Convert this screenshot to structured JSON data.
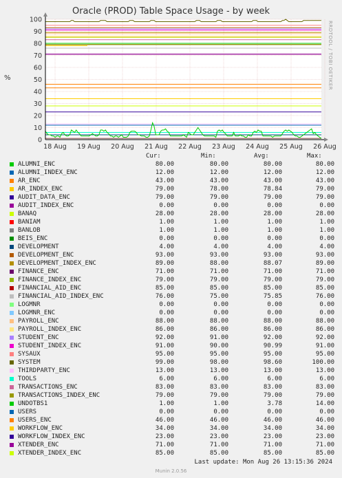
{
  "chart_data": {
    "type": "line",
    "title": "Oracle (PROD) Table Space Usage - by week",
    "ylabel": "%",
    "ylim": [
      0,
      100
    ],
    "yticks": [
      0,
      10,
      20,
      30,
      40,
      50,
      60,
      70,
      80,
      90,
      100
    ],
    "xticks": [
      "18 Aug",
      "19 Aug",
      "20 Aug",
      "21 Aug",
      "22 Aug",
      "23 Aug",
      "24 Aug",
      "25 Aug",
      "26 Aug"
    ],
    "grid": true,
    "header": {
      "cur": "Cur:",
      "min": "Min:",
      "avg": "Avg:",
      "max": "Max:"
    },
    "series": [
      {
        "name": "ALUMNI_ENC",
        "color": "#00cc00",
        "cur": "80.00",
        "min": "80.00",
        "avg": "80.00",
        "max": "80.00"
      },
      {
        "name": "ALUMNI_INDEX_ENC",
        "color": "#0066b3",
        "cur": "12.00",
        "min": "12.00",
        "avg": "12.00",
        "max": "12.00"
      },
      {
        "name": "AR_ENC",
        "color": "#ff8000",
        "cur": "43.00",
        "min": "43.00",
        "avg": "43.00",
        "max": "43.00"
      },
      {
        "name": "AR_INDEX_ENC",
        "color": "#ffcc00",
        "cur": "79.00",
        "min": "78.00",
        "avg": "78.84",
        "max": "79.00"
      },
      {
        "name": "AUDIT_DATA_ENC",
        "color": "#330099",
        "cur": "79.00",
        "min": "79.00",
        "avg": "79.00",
        "max": "79.00"
      },
      {
        "name": "AUDIT_INDEX_ENC",
        "color": "#990099",
        "cur": "0.00",
        "min": "0.00",
        "avg": "0.00",
        "max": "0.00"
      },
      {
        "name": "BANAQ",
        "color": "#ccff00",
        "cur": "28.00",
        "min": "28.00",
        "avg": "28.00",
        "max": "28.00"
      },
      {
        "name": "BANIAM",
        "color": "#ff0000",
        "cur": "1.00",
        "min": "1.00",
        "avg": "1.00",
        "max": "1.00"
      },
      {
        "name": "BANLOB",
        "color": "#808080",
        "cur": "1.00",
        "min": "1.00",
        "avg": "1.00",
        "max": "1.00"
      },
      {
        "name": "BEIS_ENC",
        "color": "#008f00",
        "cur": "0.00",
        "min": "0.00",
        "avg": "0.00",
        "max": "0.00"
      },
      {
        "name": "DEVELOPMENT",
        "color": "#00487d",
        "cur": "4.00",
        "min": "4.00",
        "avg": "4.00",
        "max": "4.00"
      },
      {
        "name": "DEVELOPMENT_ENC",
        "color": "#b35a00",
        "cur": "93.00",
        "min": "93.00",
        "avg": "93.00",
        "max": "93.00"
      },
      {
        "name": "DEVELOPMENT_INDEX_ENC",
        "color": "#b38f00",
        "cur": "89.00",
        "min": "88.00",
        "avg": "88.07",
        "max": "89.00"
      },
      {
        "name": "FINANCE_ENC",
        "color": "#6b006b",
        "cur": "71.00",
        "min": "71.00",
        "avg": "71.00",
        "max": "71.00"
      },
      {
        "name": "FINANCE_INDEX_ENC",
        "color": "#8fb300",
        "cur": "79.00",
        "min": "79.00",
        "avg": "79.00",
        "max": "79.00"
      },
      {
        "name": "FINANCIAL_AID_ENC",
        "color": "#b30000",
        "cur": "85.00",
        "min": "85.00",
        "avg": "85.00",
        "max": "85.00"
      },
      {
        "name": "FINANCIAL_AID_INDEX_ENC",
        "color": "#bebebe",
        "cur": "76.00",
        "min": "75.00",
        "avg": "75.85",
        "max": "76.00"
      },
      {
        "name": "LOGMNR",
        "color": "#80ff80",
        "cur": "0.00",
        "min": "0.00",
        "avg": "0.00",
        "max": "0.00"
      },
      {
        "name": "LOGMNR_ENC",
        "color": "#80c9ff",
        "cur": "0.00",
        "min": "0.00",
        "avg": "0.00",
        "max": "0.00"
      },
      {
        "name": "PAYROLL_ENC",
        "color": "#ffc080",
        "cur": "88.00",
        "min": "88.00",
        "avg": "88.00",
        "max": "88.00"
      },
      {
        "name": "PAYROLL_INDEX_ENC",
        "color": "#ffe680",
        "cur": "86.00",
        "min": "86.00",
        "avg": "86.00",
        "max": "86.00"
      },
      {
        "name": "STUDENT_ENC",
        "color": "#aa80ff",
        "cur": "92.00",
        "min": "91.00",
        "avg": "92.00",
        "max": "92.00"
      },
      {
        "name": "STUDENT_INDEX_ENC",
        "color": "#ee00cc",
        "cur": "91.00",
        "min": "90.00",
        "avg": "90.99",
        "max": "91.00"
      },
      {
        "name": "SYSAUX",
        "color": "#ff8080",
        "cur": "95.00",
        "min": "95.00",
        "avg": "95.00",
        "max": "95.00"
      },
      {
        "name": "SYSTEM",
        "color": "#666600",
        "cur": "99.00",
        "min": "98.00",
        "avg": "98.60",
        "max": "100.00"
      },
      {
        "name": "THIRDPARTY_ENC",
        "color": "#ffbfff",
        "cur": "13.00",
        "min": "13.00",
        "avg": "13.00",
        "max": "13.00"
      },
      {
        "name": "TOOLS",
        "color": "#00ffcc",
        "cur": "6.00",
        "min": "6.00",
        "avg": "6.00",
        "max": "6.00"
      },
      {
        "name": "TRANSACTIONS_ENC",
        "color": "#cc6699",
        "cur": "83.00",
        "min": "83.00",
        "avg": "83.00",
        "max": "83.00"
      },
      {
        "name": "TRANSACTIONS_INDEX_ENC",
        "color": "#999900",
        "cur": "79.00",
        "min": "79.00",
        "avg": "79.00",
        "max": "79.00"
      },
      {
        "name": "UNDOTBS1",
        "color": "#00cc00",
        "cur": "1.00",
        "min": "1.00",
        "avg": "3.78",
        "max": "14.00"
      },
      {
        "name": "USERS",
        "color": "#0066b3",
        "cur": "0.00",
        "min": "0.00",
        "avg": "0.00",
        "max": "0.00"
      },
      {
        "name": "USERS_ENC",
        "color": "#ff8000",
        "cur": "46.00",
        "min": "46.00",
        "avg": "46.00",
        "max": "46.00"
      },
      {
        "name": "WORKFLOW_ENC",
        "color": "#ffcc00",
        "cur": "34.00",
        "min": "34.00",
        "avg": "34.00",
        "max": "34.00"
      },
      {
        "name": "WORKFLOW_INDEX_ENC",
        "color": "#330099",
        "cur": "23.00",
        "min": "23.00",
        "avg": "23.00",
        "max": "23.00"
      },
      {
        "name": "XTENDER_ENC",
        "color": "#990099",
        "cur": "71.00",
        "min": "71.00",
        "avg": "71.00",
        "max": "71.00"
      },
      {
        "name": "XTENDER_INDEX_ENC",
        "color": "#ccff00",
        "cur": "85.00",
        "min": "85.00",
        "avg": "85.00",
        "max": "85.00"
      }
    ],
    "undotbs1_values": [
      7,
      5,
      4,
      4,
      3,
      3,
      2,
      3,
      3,
      2,
      5,
      6,
      4,
      3,
      3,
      4,
      8,
      7,
      6,
      8,
      6,
      5,
      3,
      3,
      3,
      3,
      3,
      3,
      4,
      5,
      4,
      3,
      3,
      4,
      8,
      8,
      7,
      8,
      6,
      5,
      3,
      3,
      2,
      3,
      3,
      2,
      3,
      4,
      2,
      2,
      2,
      3,
      6,
      7,
      7,
      7,
      6,
      4,
      4,
      3,
      3,
      3,
      2,
      2,
      3,
      8,
      14,
      11,
      4,
      4,
      4,
      7,
      8,
      8,
      9,
      7,
      6,
      3,
      3,
      3,
      3,
      3,
      3,
      3,
      3,
      4,
      3,
      2,
      6,
      5,
      4,
      4,
      6,
      8,
      10,
      8,
      6,
      4,
      3,
      3,
      3,
      3,
      3,
      3,
      3,
      2,
      7,
      8,
      7,
      8,
      6,
      5,
      3,
      3,
      3,
      3,
      6,
      3,
      3,
      3,
      4,
      3,
      3,
      2,
      2,
      4,
      3,
      3,
      6,
      7,
      6,
      8,
      7,
      7,
      3,
      3,
      3,
      3,
      3,
      3,
      2,
      3,
      3,
      3,
      3,
      3,
      5,
      7,
      8,
      7,
      8,
      7,
      6,
      4,
      3,
      3,
      2,
      2,
      3,
      4,
      5,
      6,
      7,
      8,
      9,
      5,
      6,
      4,
      3,
      2,
      1
    ],
    "system_values": [
      98,
      98,
      98,
      98,
      98,
      98,
      98,
      98,
      98,
      98,
      98,
      98,
      98,
      98,
      98,
      98,
      99,
      99,
      98,
      98,
      98,
      98,
      98,
      98,
      98,
      98,
      98,
      98,
      98,
      98,
      98,
      98,
      98,
      98,
      99,
      99,
      99,
      99,
      98,
      98,
      98,
      98,
      98,
      98,
      98,
      98,
      98,
      98,
      98,
      98,
      98,
      98,
      99,
      99,
      99,
      98,
      98,
      98,
      98,
      98,
      98,
      98,
      98,
      98,
      98,
      99,
      99,
      99,
      98,
      98,
      98,
      98,
      98,
      98,
      98,
      98,
      98,
      98,
      98,
      98,
      98,
      98,
      98,
      98,
      98,
      98,
      98,
      98,
      98,
      98,
      98,
      98,
      98,
      99,
      99,
      99,
      98,
      98,
      98,
      98,
      98,
      98,
      98,
      98,
      98,
      98,
      99,
      99,
      99,
      98,
      98,
      98,
      98,
      98,
      98,
      98,
      98,
      98,
      98,
      98,
      98,
      98,
      98,
      98,
      98,
      98,
      98,
      98,
      99,
      99,
      99,
      98,
      98,
      98,
      98,
      98,
      98,
      98,
      98,
      98,
      98,
      98,
      98,
      98,
      98,
      98,
      99,
      99,
      100,
      99,
      98,
      98,
      98,
      98,
      98,
      98,
      98,
      98,
      98,
      99,
      99,
      99,
      99,
      99,
      99,
      99,
      99,
      99,
      99,
      99,
      99
    ]
  },
  "footer": {
    "last_update": "Last update: Mon Aug 26 13:15:36 2024",
    "munin": "Munin 2.0.56",
    "watermark": "RRDTOOL / TOBI OETIKER"
  }
}
